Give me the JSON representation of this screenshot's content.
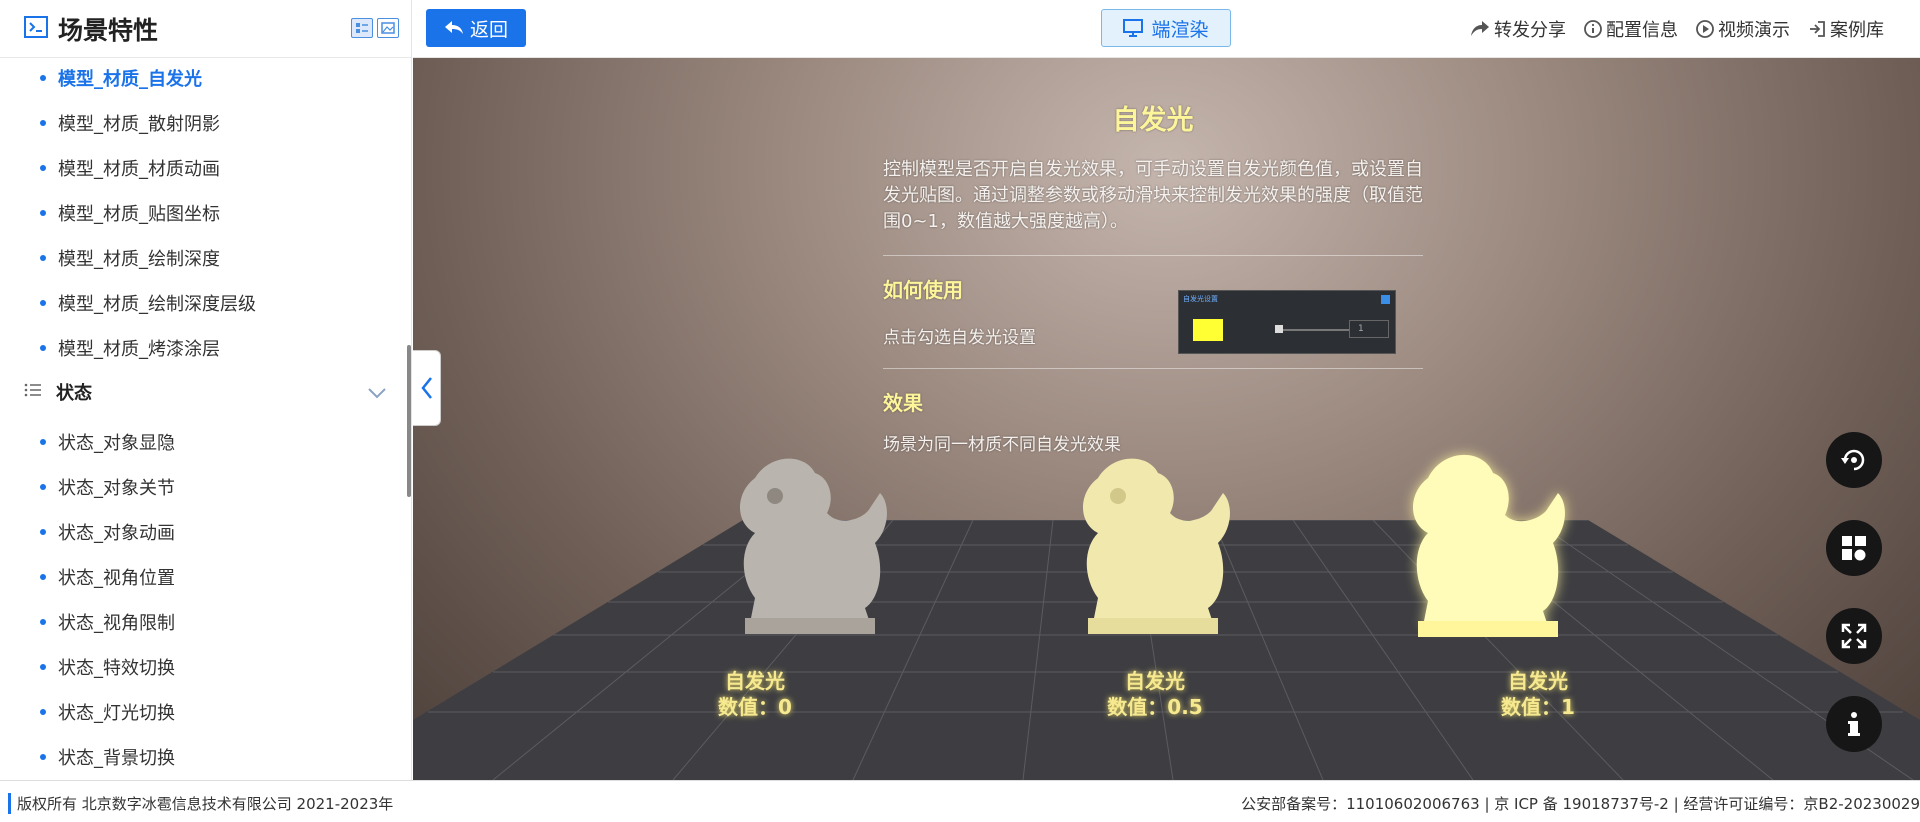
{
  "sidebar": {
    "title": "场景特性",
    "items": [
      {
        "label": "模型_材质_自发光",
        "active": true
      },
      {
        "label": "模型_材质_散射阴影"
      },
      {
        "label": "模型_材质_材质动画"
      },
      {
        "label": "模型_材质_贴图坐标"
      },
      {
        "label": "模型_材质_绘制深度"
      },
      {
        "label": "模型_材质_绘制深度层级"
      },
      {
        "label": "模型_材质_烤漆涂层"
      }
    ],
    "group": {
      "label": "状态"
    },
    "group_items": [
      {
        "label": "状态_对象显隐"
      },
      {
        "label": "状态_对象关节"
      },
      {
        "label": "状态_对象动画"
      },
      {
        "label": "状态_视角位置"
      },
      {
        "label": "状态_视角限制"
      },
      {
        "label": "状态_特效切换"
      },
      {
        "label": "状态_灯光切换"
      },
      {
        "label": "状态_背景切换"
      }
    ]
  },
  "topbar": {
    "back_label": "返回",
    "render_label": "端渲染",
    "links": [
      "转发分享",
      "配置信息",
      "视频演示",
      "案例库"
    ]
  },
  "scene": {
    "title": "自发光",
    "description": "控制模型是否开启自发光效果，可手动设置自发光颜色值，或设置自发光贴图。通过调整参数或移动滑块来控制发光效果的强度（取值范围0~1，数值越大强度越高）。",
    "how_title": "如何使用",
    "how_text": "点击勾选自发光设置",
    "effect_title": "效果",
    "effect_text": "场景为同一材质不同自发光效果",
    "mini_panel_title": "自发光设置",
    "mini_value": "1",
    "labels": [
      {
        "name": "自发光",
        "value": "数值：0"
      },
      {
        "name": "自发光",
        "value": "数值：0.5"
      },
      {
        "name": "自发光",
        "value": "数值：1"
      }
    ]
  },
  "footer": {
    "copyright": "版权所有 北京数字冰雹信息技术有限公司 2021-2023年",
    "records": "公安部备案号：11010602006763 | 京 ICP 备 19018737号-2 | 经营许可证编号：京B2-20230029"
  },
  "colors": {
    "accent": "#1a73e8",
    "glow": "#fdf59a",
    "swatch": "#ffff33"
  }
}
